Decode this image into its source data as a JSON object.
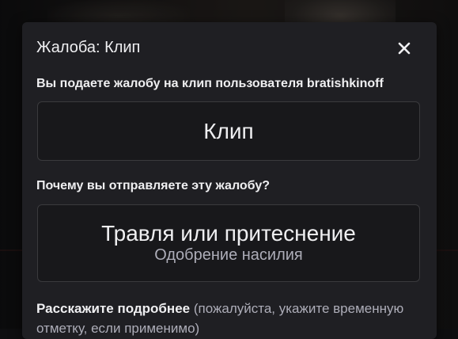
{
  "modal": {
    "title": "Жалоба: Клип",
    "close_icon": "close-icon",
    "target_label": "Вы подаете жалобу на клип пользователя bratishkinoff",
    "target_value": "Клип",
    "reason_label": "Почему вы отправляете эту жалобу?",
    "reason_value": "Травля или притеснение",
    "reason_subvalue": "Одобрение насилия",
    "details_label_bold": "Расскажите подробнее",
    "details_label_hint": "(пожалуйста, укажите временную отметку, если применимо)"
  },
  "colors": {
    "modal_bg": "#1f1f23",
    "field_bg": "#18181b",
    "text_primary": "#efeff1",
    "text_secondary": "#adadb8"
  }
}
